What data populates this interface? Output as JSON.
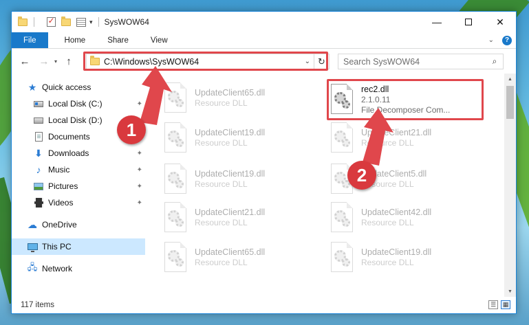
{
  "window": {
    "title": "SysWOW64"
  },
  "ribbon": {
    "tabs": [
      "File",
      "Home",
      "Share",
      "View"
    ]
  },
  "address": {
    "path": "C:\\Windows\\SysWOW64"
  },
  "search": {
    "placeholder": "Search SysWOW64"
  },
  "sidebar": {
    "items": [
      {
        "label": "Quick access",
        "icon": "star-icon",
        "pinned": false
      },
      {
        "label": "Local Disk (C:)",
        "icon": "drive-c-icon",
        "pinned": true
      },
      {
        "label": "Local Disk (D:)",
        "icon": "drive-d-icon",
        "pinned": true
      },
      {
        "label": "Documents",
        "icon": "documents-icon",
        "pinned": true
      },
      {
        "label": "Downloads",
        "icon": "downloads-icon",
        "pinned": true
      },
      {
        "label": "Music",
        "icon": "music-icon",
        "pinned": true
      },
      {
        "label": "Pictures",
        "icon": "pictures-icon",
        "pinned": true
      },
      {
        "label": "Videos",
        "icon": "videos-icon",
        "pinned": true
      },
      {
        "label": "OneDrive",
        "icon": "onedrive-icon",
        "pinned": false
      },
      {
        "label": "This PC",
        "icon": "this-pc-icon",
        "pinned": false,
        "selected": true
      },
      {
        "label": "Network",
        "icon": "network-icon",
        "pinned": false
      }
    ]
  },
  "files": {
    "left_column": [
      {
        "name": "UpdateClient65.dll",
        "type": "Resource DLL"
      },
      {
        "name": "UpdateClient19.dll",
        "type": "Resource DLL"
      },
      {
        "name": "UpdateClient19.dll",
        "type": "Resource DLL"
      },
      {
        "name": "UpdateClient21.dll",
        "type": "Resource DLL"
      },
      {
        "name": "UpdateClient65.dll",
        "type": "Resource DLL"
      }
    ],
    "right_column": [
      {
        "name": "rec2.dll",
        "version": "2.1.0.11",
        "type": "File Decomposer Com..."
      },
      {
        "name": "UpdateClient21.dll",
        "type": "Resource DLL"
      },
      {
        "name": "UpdateClient5.dll",
        "type": "Resource DLL"
      },
      {
        "name": "UpdateClient42.dll",
        "type": "Resource DLL"
      },
      {
        "name": "UpdateClient19.dll",
        "type": "Resource DLL"
      }
    ]
  },
  "status": {
    "item_count": "117 items"
  },
  "callouts": {
    "first": "1",
    "second": "2"
  },
  "colors": {
    "accent": "#1979ca",
    "highlight": "#e0474c",
    "selected": "#cce8ff"
  }
}
